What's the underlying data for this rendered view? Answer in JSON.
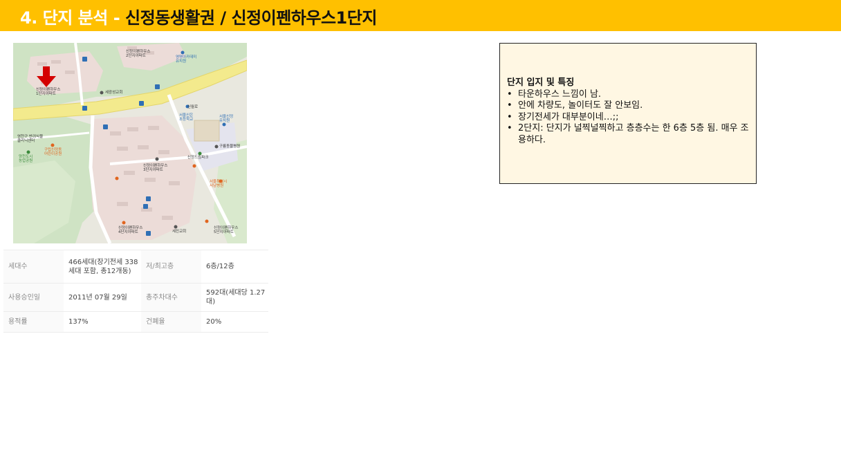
{
  "header": {
    "prefix": "4. 단지 분석 - ",
    "title": "신정동생활권 /  신정이펜하우스1단지"
  },
  "map": {
    "labels": {
      "complex1": "신정이펜하우스\n1단지아파트",
      "complex2": "신정이펜하우스\n2단지아파트",
      "complex3": "신정이펜하우스\n3단지아파트",
      "complex4": "신정이펜하우스\n4단지아파트",
      "complex5": "신정이펜하우스\n5단지아파트",
      "church": "세광성교회",
      "school_elem": "서울신은\n초등학교",
      "academy": "영명아카데미\n유치원",
      "kindergarten": "서울신정\n유치원",
      "library": "영천구 반려식물\n클리닉센터",
      "park_g": "구립신정동\n어린이공원",
      "park_c": "양천도시\n농업공원",
      "station": "구룡동물병원",
      "small_park": "신정드림파크",
      "hospital": "서울특별시\n서남병원",
      "office": "서울특별시\n서남병원",
      "road": "신월로",
      "cafe": "세진교회"
    }
  },
  "info_table": {
    "rows": [
      {
        "k1": "세대수",
        "v1": "466세대(장기전세 338세대 포함, 총12개동)",
        "k2": "저/최고층",
        "v2": "6층/12층"
      },
      {
        "k1": "사용승인일",
        "v1": "2011년 07월 29일",
        "k2": "총주차대수",
        "v2": "592대(세대당 1.27대)"
      },
      {
        "k1": "용적률",
        "v1": "137%",
        "k2": "건폐율",
        "v2": "20%"
      }
    ]
  },
  "note": {
    "title": "단지 입지 및 특징",
    "items": [
      "타운하우스 느낌이 남.",
      "안에 차량도, 놀이터도 잘 안보임.",
      "장기전세가 대부분이네…;;",
      "2단지: 단지가 널찍널찍하고 층층수는 한 6층 5층 됨. 매우 조용하다."
    ]
  },
  "colors": {
    "header_bg": "#ffc000",
    "header_prefix": "#ffffff",
    "header_title": "#111111",
    "note_bg": "#fff7e3",
    "marker": "#d40000"
  }
}
